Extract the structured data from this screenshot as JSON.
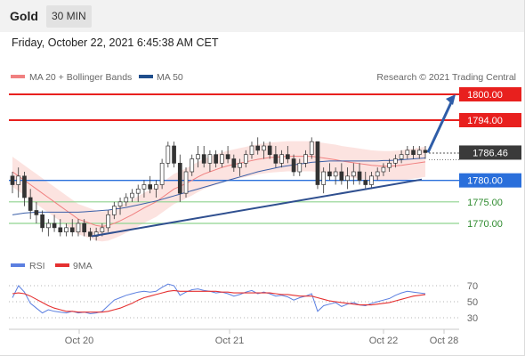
{
  "header": {
    "title": "Gold",
    "timeframe": "30 MIN",
    "datetime": "Friday, October 22, 2021 6:45:38 AM CET"
  },
  "legend": {
    "ma20_bb": {
      "label": "MA 20 + Bollinger Bands",
      "color": "#f08080"
    },
    "ma50": {
      "label": "MA 50",
      "color": "#1f4e8c"
    },
    "credit": "Research © 2021 Trading Central"
  },
  "chart_data": {
    "type": "candlestick",
    "instrument": "Gold",
    "timeframe": "30 MIN",
    "y_range": [
      1763,
      1803
    ],
    "levels": [
      {
        "label": "1800.00",
        "value": 1800.0,
        "color": "#e8201e",
        "style": "resistance"
      },
      {
        "label": "1794.00",
        "value": 1794.0,
        "color": "#e8201e",
        "style": "resistance"
      },
      {
        "label": "1786.46",
        "value": 1786.46,
        "color": "#333333",
        "style": "last-price"
      },
      {
        "label": "1780.00",
        "value": 1780.0,
        "color": "#2a6fdb",
        "style": "pivot"
      },
      {
        "label": "1775.00",
        "value": 1775.0,
        "color": "#2e8b2e",
        "style": "support"
      },
      {
        "label": "1770.00",
        "value": 1770.0,
        "color": "#2e8b2e",
        "style": "support"
      }
    ],
    "x_labels": [
      "Oct 20",
      "Oct 21",
      "Oct 22",
      "Oct 28"
    ],
    "ohlc": [
      [
        1781,
        1782,
        1777,
        1779
      ],
      [
        1779,
        1783,
        1776,
        1781
      ],
      [
        1781,
        1782,
        1774,
        1776
      ],
      [
        1776,
        1778,
        1771,
        1773
      ],
      [
        1773,
        1775,
        1770,
        1772
      ],
      [
        1772,
        1773,
        1768,
        1769
      ],
      [
        1769,
        1771,
        1767,
        1770
      ],
      [
        1770,
        1772,
        1768,
        1769
      ],
      [
        1769,
        1771,
        1767,
        1768
      ],
      [
        1768,
        1770,
        1767,
        1769
      ],
      [
        1769,
        1771,
        1767,
        1768
      ],
      [
        1768,
        1771,
        1767,
        1770
      ],
      [
        1770,
        1771,
        1767,
        1768
      ],
      [
        1768,
        1769,
        1766,
        1767
      ],
      [
        1767,
        1769,
        1766,
        1768
      ],
      [
        1768,
        1770,
        1767,
        1769
      ],
      [
        1769,
        1773,
        1768,
        1772
      ],
      [
        1772,
        1775,
        1771,
        1774
      ],
      [
        1774,
        1776,
        1772,
        1775
      ],
      [
        1775,
        1777,
        1774,
        1776
      ],
      [
        1776,
        1778,
        1775,
        1777
      ],
      [
        1777,
        1779,
        1775,
        1778
      ],
      [
        1778,
        1780,
        1776,
        1779
      ],
      [
        1779,
        1781,
        1777,
        1778
      ],
      [
        1778,
        1780,
        1776,
        1779
      ],
      [
        1779,
        1785,
        1778,
        1784
      ],
      [
        1784,
        1789,
        1783,
        1788
      ],
      [
        1788,
        1789,
        1783,
        1784
      ],
      [
        1784,
        1786,
        1775,
        1777
      ],
      [
        1777,
        1783,
        1776,
        1782
      ],
      [
        1782,
        1786,
        1781,
        1785
      ],
      [
        1785,
        1788,
        1783,
        1786
      ],
      [
        1786,
        1788,
        1783,
        1784
      ],
      [
        1784,
        1787,
        1782,
        1786
      ],
      [
        1786,
        1787,
        1783,
        1784
      ],
      [
        1784,
        1787,
        1783,
        1786
      ],
      [
        1786,
        1788,
        1784,
        1785
      ],
      [
        1785,
        1786,
        1782,
        1783
      ],
      [
        1783,
        1785,
        1781,
        1784
      ],
      [
        1784,
        1787,
        1783,
        1786
      ],
      [
        1786,
        1789,
        1785,
        1788
      ],
      [
        1788,
        1790,
        1786,
        1787
      ],
      [
        1787,
        1789,
        1785,
        1788
      ],
      [
        1788,
        1789,
        1785,
        1786
      ],
      [
        1786,
        1788,
        1783,
        1784
      ],
      [
        1784,
        1787,
        1783,
        1786
      ],
      [
        1786,
        1788,
        1784,
        1785
      ],
      [
        1785,
        1786,
        1781,
        1782
      ],
      [
        1782,
        1785,
        1781,
        1784
      ],
      [
        1784,
        1787,
        1783,
        1786
      ],
      [
        1786,
        1790,
        1785,
        1789
      ],
      [
        1789,
        1789,
        1778,
        1779
      ],
      [
        1779,
        1783,
        1777,
        1782
      ],
      [
        1782,
        1784,
        1780,
        1781
      ],
      [
        1781,
        1783,
        1779,
        1782
      ],
      [
        1782,
        1784,
        1779,
        1780
      ],
      [
        1780,
        1783,
        1778,
        1781
      ],
      [
        1781,
        1784,
        1779,
        1782
      ],
      [
        1782,
        1784,
        1779,
        1780
      ],
      [
        1780,
        1782,
        1778,
        1779
      ],
      [
        1779,
        1782,
        1778,
        1781
      ],
      [
        1781,
        1783,
        1780,
        1782
      ],
      [
        1782,
        1784,
        1781,
        1783
      ],
      [
        1783,
        1785,
        1782,
        1784
      ],
      [
        1784,
        1786,
        1783,
        1785
      ],
      [
        1785,
        1787,
        1784,
        1786
      ],
      [
        1786,
        1788,
        1785,
        1787
      ],
      [
        1787,
        1788,
        1785,
        1786
      ],
      [
        1786,
        1788,
        1785,
        1787
      ],
      [
        1787,
        1788,
        1785,
        1786.46
      ]
    ],
    "ma20": [
      1782,
      1781,
      1780,
      1779,
      1778,
      1777,
      1776,
      1775,
      1774,
      1773,
      1772,
      1771,
      1770.5,
      1770,
      1769.5,
      1769.3,
      1769.5,
      1770,
      1770.6,
      1771.3,
      1772,
      1772.8,
      1773.6,
      1774.3,
      1775,
      1776,
      1777,
      1778,
      1778.6,
      1779.3,
      1780,
      1780.8,
      1781.5,
      1782,
      1782.5,
      1783,
      1783.4,
      1783.7,
      1784,
      1784.3,
      1784.6,
      1784.9,
      1785.1,
      1785.3,
      1785.4,
      1785.5,
      1785.6,
      1785.6,
      1785.6,
      1785.6,
      1785.6,
      1785.4,
      1785.2,
      1785,
      1784.8,
      1784.5,
      1784.3,
      1784.1,
      1783.9,
      1783.7,
      1783.5,
      1783.4,
      1783.3,
      1783.3,
      1783.4,
      1783.5,
      1783.7,
      1783.9,
      1784.1,
      1784.3
    ],
    "ma50": [
      1772,
      1772.2,
      1772.4,
      1772.5,
      1772.6,
      1772.6,
      1772.6,
      1772.6,
      1772.6,
      1772.6,
      1772.6,
      1772.6,
      1772.7,
      1772.8,
      1772.9,
      1773,
      1773.1,
      1773.3,
      1773.5,
      1773.7,
      1774,
      1774.3,
      1774.6,
      1774.9,
      1775.2,
      1775.6,
      1776,
      1776.4,
      1776.8,
      1777.2,
      1777.6,
      1778,
      1778.4,
      1778.8,
      1779.2,
      1779.6,
      1780,
      1780.4,
      1780.8,
      1781.2,
      1781.6,
      1782,
      1782.3,
      1782.6,
      1782.9,
      1783.2,
      1783.4,
      1783.6,
      1783.8,
      1784,
      1784.2,
      1784.3,
      1784.4,
      1784.5,
      1784.5,
      1784.5,
      1784.5,
      1784.5,
      1784.5,
      1784.5,
      1784.5,
      1784.5,
      1784.6,
      1784.6,
      1784.7,
      1784.8,
      1784.9,
      1785,
      1785.1,
      1785.2
    ],
    "bb_width": 3.5,
    "trendline": {
      "from": [
        16,
        1767
      ],
      "to": [
        69,
        1780.2
      ]
    },
    "arrow": {
      "from_value": 1786.5,
      "to_value": 1800.0
    },
    "rsi": {
      "label": "RSI",
      "color": "#5b7fe0",
      "ma_label": "9MA",
      "ma_color": "#e53030",
      "levels": [
        "70",
        "50",
        "30"
      ],
      "y_range": [
        20,
        80
      ],
      "values": [
        55,
        70,
        62,
        48,
        42,
        36,
        40,
        38,
        37,
        36,
        38,
        36,
        37,
        35,
        36,
        38,
        45,
        52,
        55,
        58,
        60,
        62,
        63,
        62,
        63,
        68,
        72,
        70,
        58,
        62,
        65,
        66,
        64,
        63,
        61,
        62,
        60,
        57,
        59,
        62,
        64,
        60,
        62,
        60,
        57,
        58,
        56,
        52,
        55,
        57,
        60,
        38,
        45,
        47,
        49,
        44,
        47,
        49,
        46,
        45,
        48,
        50,
        52,
        54,
        58,
        61,
        63,
        62,
        61,
        60
      ],
      "ma": [
        60,
        61,
        60,
        57,
        53,
        49,
        45,
        42,
        40,
        38,
        38,
        37,
        37,
        37,
        37,
        37,
        38,
        40,
        42,
        45,
        48,
        52,
        55,
        57,
        59,
        61,
        63,
        64,
        63,
        63,
        63,
        63,
        63,
        63,
        63,
        62,
        62,
        61,
        61,
        61,
        61,
        61,
        61,
        61,
        60,
        59,
        59,
        58,
        57,
        57,
        57,
        55,
        53,
        51,
        50,
        49,
        48,
        47,
        46,
        46,
        46,
        47,
        48,
        49,
        51,
        53,
        55,
        57,
        58,
        59
      ]
    }
  }
}
